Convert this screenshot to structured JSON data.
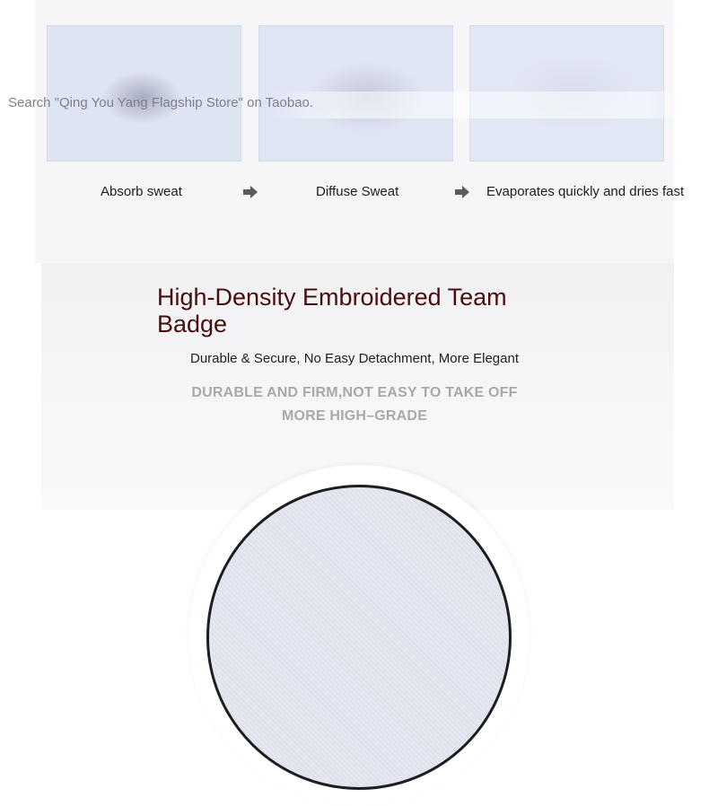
{
  "watermark": "Search \"Qing You Yang Flagship Store\" on Taobao.",
  "steps": [
    {
      "label": "Absorb sweat"
    },
    {
      "label": "Diffuse Sweat"
    },
    {
      "label": "Evaporates quickly and dries fast"
    }
  ],
  "arrow_icon": "right-arrow-icon",
  "feature": {
    "title": "High-Density Embroidered Team Badge",
    "subtitle": "Durable & Secure, No Easy Detachment, More Elegant",
    "english_line1": "DURABLE AND FIRM,NOT EASY TO TAKE OFF",
    "english_line2": "MORE HIGH–GRADE"
  },
  "colors": {
    "title": "#4a0d0d",
    "english_text": "#a9a9ad",
    "watermark": "#7d7f8e"
  }
}
